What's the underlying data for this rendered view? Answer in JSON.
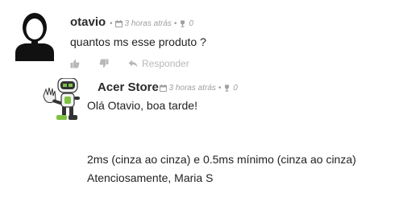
{
  "comments": [
    {
      "author": "otavio",
      "time": "3 horas atrás",
      "votes": "0",
      "body": "quantos ms esse produto ?",
      "reply_label": "Responder"
    },
    {
      "author": "Acer Store",
      "time": "3 horas atrás",
      "votes": "0",
      "greeting": "Olá Otavio, boa tarde!",
      "line1": "2ms (cinza ao cinza) e 0.5ms mínimo (cinza ao cinza)",
      "line2": "Atenciosamente, Maria S"
    }
  ],
  "icons": {
    "calendar": "calendar-icon",
    "vote": "trophy-icon",
    "like": "thumbs-up-icon",
    "dislike": "thumbs-down-icon",
    "reply": "reply-arrow-icon"
  },
  "colors": {
    "meta": "#a0a0a0",
    "action": "#b8b8b8",
    "mascot_green": "#7ec242"
  }
}
